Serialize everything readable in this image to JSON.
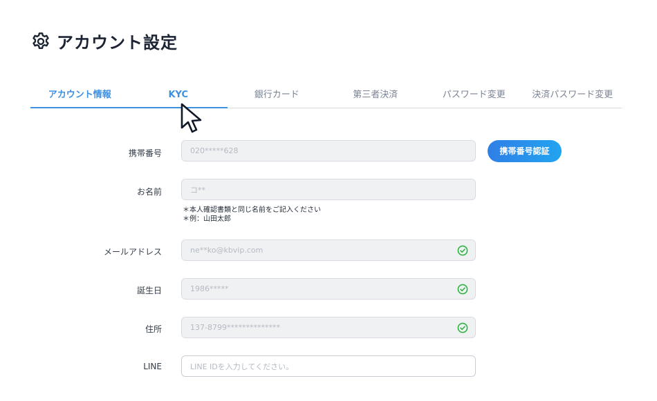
{
  "header": {
    "title": "アカウント設定",
    "icon": "gear-icon"
  },
  "tabs": [
    {
      "label": "アカウント情報"
    },
    {
      "label": "KYC"
    },
    {
      "label": "銀行カード"
    },
    {
      "label": "第三者決済"
    },
    {
      "label": "パスワード変更"
    },
    {
      "label": "決済パスワード変更"
    }
  ],
  "form": {
    "phone": {
      "label": "携帯番号",
      "value": "020*****628",
      "button": "携帯番号認証"
    },
    "name": {
      "label": "お名前",
      "value": "コ**",
      "hint1": "＊本人確認書類と同じ名前をご記入ください",
      "hint2": "＊例：山田太郎"
    },
    "email": {
      "label": "メールアドレス",
      "value": "ne**ko@kbvip.com",
      "verified": true
    },
    "birthday": {
      "label": "誕生日",
      "value": "1986*****",
      "verified": true
    },
    "address": {
      "label": "住所",
      "value": "137-8799**************",
      "verified": true
    },
    "line": {
      "label": "LINE",
      "placeholder": "LINE IDを入力してください。"
    }
  },
  "colors": {
    "accent": "#3d8fe0",
    "check": "#2fb344",
    "button_start": "#2f7fe6",
    "button_end": "#22a4f0"
  }
}
